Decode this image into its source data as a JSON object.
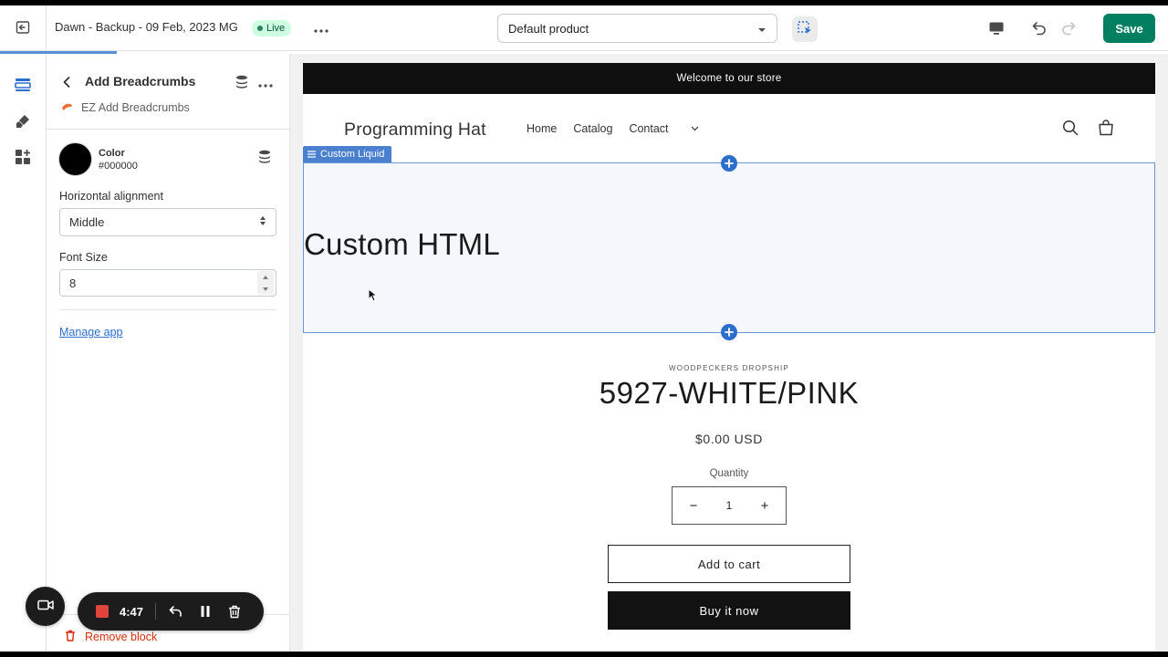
{
  "topbar": {
    "theme_name": "Dawn - Backup - 09 Feb, 2023 MG",
    "live_label": "Live",
    "template_value": "Default product",
    "save_label": "Save"
  },
  "progress": {
    "fraction": 0.1
  },
  "sidebar": {
    "title": "Add Breadcrumbs",
    "app_name": "EZ Add Breadcrumbs",
    "color": {
      "label": "Color",
      "value": "#000000",
      "swatch": "#000000"
    },
    "alignment": {
      "label": "Horizontal alignment",
      "value": "Middle"
    },
    "font_size": {
      "label": "Font Size",
      "value": "8"
    },
    "manage_link": "Manage app",
    "remove_label": "Remove block"
  },
  "recorder": {
    "time": "4:47"
  },
  "preview": {
    "announcement": "Welcome to our store",
    "store_name": "Programming Hat",
    "nav": [
      "Home",
      "Catalog",
      "Contact"
    ],
    "section_tag": "Custom Liquid",
    "custom_html": "Custom HTML",
    "vendor": "WOODPECKERS DROPSHIP",
    "product_title": "5927-WHITE/PINK",
    "price": "$0.00 USD",
    "quantity_label": "Quantity",
    "quantity_value": "1",
    "add_to_cart": "Add to cart",
    "buy_now": "Buy it now"
  },
  "colors": {
    "save": "#008060",
    "live_badge": "#cdfee1",
    "selection": "#2c6ecb",
    "remove": "#d72c0d"
  },
  "icons": [
    "exit-icon",
    "more-horizontal-icon",
    "chevron-down-icon",
    "inspector-icon",
    "desktop-icon",
    "undo-icon",
    "redo-icon",
    "sections-icon",
    "theme-settings-icon",
    "apps-icon",
    "back-arrow-icon",
    "database-stack-icon",
    "app-logo-icon",
    "select-arrows-icon",
    "trash-icon",
    "camera-icon",
    "stop-icon",
    "rewind-icon",
    "pause-icon",
    "search-icon",
    "cart-icon",
    "plus-icon",
    "cursor-icon"
  ]
}
